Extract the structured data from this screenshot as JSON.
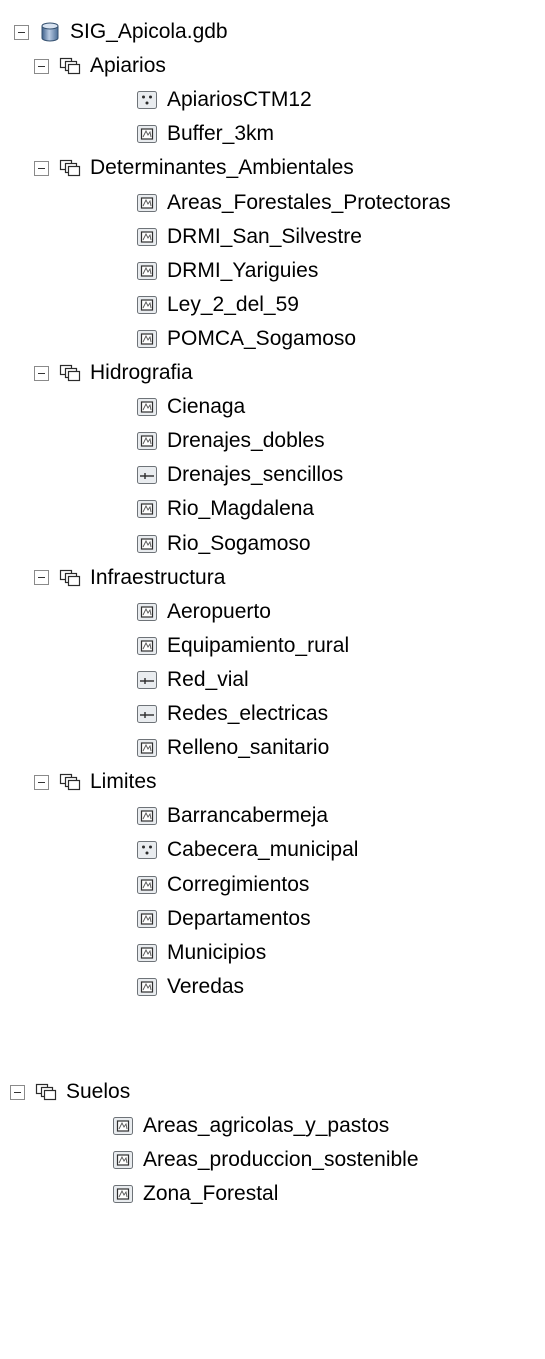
{
  "tree": {
    "root": {
      "label": "SIG_Apicola.gdb",
      "icon": "database-icon",
      "expanded": true
    },
    "datasets": [
      {
        "label": "Apiarios",
        "icon": "feature-dataset-icon",
        "expanded": true,
        "items": [
          {
            "label": "ApiariosCTM12",
            "icon": "point-feature-class-icon"
          },
          {
            "label": "Buffer_3km",
            "icon": "polygon-feature-class-icon"
          }
        ]
      },
      {
        "label": "Determinantes_Ambientales",
        "icon": "feature-dataset-icon",
        "expanded": true,
        "items": [
          {
            "label": "Areas_Forestales_Protectoras",
            "icon": "polygon-feature-class-icon"
          },
          {
            "label": "DRMI_San_Silvestre",
            "icon": "polygon-feature-class-icon"
          },
          {
            "label": "DRMI_Yariguies",
            "icon": "polygon-feature-class-icon"
          },
          {
            "label": "Ley_2_del_59",
            "icon": "polygon-feature-class-icon"
          },
          {
            "label": "POMCA_Sogamoso",
            "icon": "polygon-feature-class-icon"
          }
        ]
      },
      {
        "label": "Hidrografia",
        "icon": "feature-dataset-icon",
        "expanded": true,
        "items": [
          {
            "label": "Cienaga",
            "icon": "polygon-feature-class-icon"
          },
          {
            "label": "Drenajes_dobles",
            "icon": "polygon-feature-class-icon"
          },
          {
            "label": "Drenajes_sencillos",
            "icon": "line-feature-class-icon"
          },
          {
            "label": "Rio_Magdalena",
            "icon": "polygon-feature-class-icon"
          },
          {
            "label": "Rio_Sogamoso",
            "icon": "polygon-feature-class-icon"
          }
        ]
      },
      {
        "label": "Infraestructura",
        "icon": "feature-dataset-icon",
        "expanded": true,
        "items": [
          {
            "label": "Aeropuerto",
            "icon": "polygon-feature-class-icon"
          },
          {
            "label": "Equipamiento_rural",
            "icon": "polygon-feature-class-icon"
          },
          {
            "label": "Red_vial",
            "icon": "line-feature-class-icon"
          },
          {
            "label": "Redes_electricas",
            "icon": "line-feature-class-icon"
          },
          {
            "label": "Relleno_sanitario",
            "icon": "polygon-feature-class-icon"
          }
        ]
      },
      {
        "label": "Limites",
        "icon": "feature-dataset-icon",
        "expanded": true,
        "items": [
          {
            "label": "Barrancabermeja",
            "icon": "polygon-feature-class-icon"
          },
          {
            "label": "Cabecera_municipal",
            "icon": "point-feature-class-icon"
          },
          {
            "label": "Corregimientos",
            "icon": "polygon-feature-class-icon"
          },
          {
            "label": "Departamentos",
            "icon": "polygon-feature-class-icon"
          },
          {
            "label": "Municipios",
            "icon": "polygon-feature-class-icon"
          },
          {
            "label": "Veredas",
            "icon": "polygon-feature-class-icon"
          }
        ]
      },
      {
        "label": "Suelos",
        "icon": "feature-dataset-icon",
        "expanded": true,
        "items": [
          {
            "label": "Areas_agricolas_y_pastos",
            "icon": "polygon-feature-class-icon"
          },
          {
            "label": "Areas_produccion_sostenible",
            "icon": "polygon-feature-class-icon"
          },
          {
            "label": "Zona_Forestal",
            "icon": "polygon-feature-class-icon"
          }
        ]
      }
    ]
  }
}
